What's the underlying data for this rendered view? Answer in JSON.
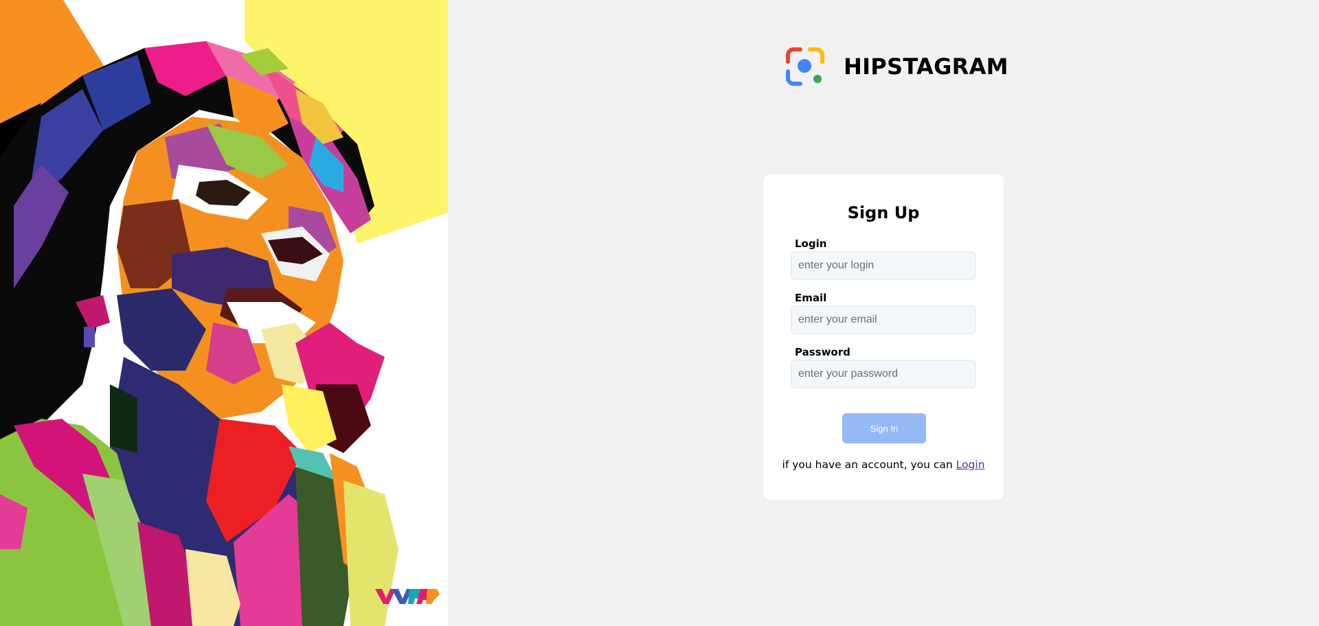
{
  "brand": {
    "name": "HIPSTAGRAM",
    "logo_colors": {
      "red": "#ea4335",
      "yellow": "#fbbc04",
      "blue": "#4285f4",
      "green": "#34a853"
    }
  },
  "art": {
    "signature_text": "WPAP"
  },
  "form": {
    "title": "Sign Up",
    "fields": {
      "login": {
        "label": "Login",
        "placeholder": "enter your login",
        "value": ""
      },
      "email": {
        "label": "Email",
        "placeholder": "enter your email",
        "value": ""
      },
      "password": {
        "label": "Password",
        "placeholder": "enter your password",
        "value": ""
      }
    },
    "submit_label": "Sign In",
    "footer_text": "if you have an account, you can",
    "footer_link": "Login"
  },
  "colors": {
    "page_background": "#f1f1f1",
    "card_background": "#ffffff",
    "button_background": "#95b9f4",
    "link_color": "#5b2e91"
  }
}
